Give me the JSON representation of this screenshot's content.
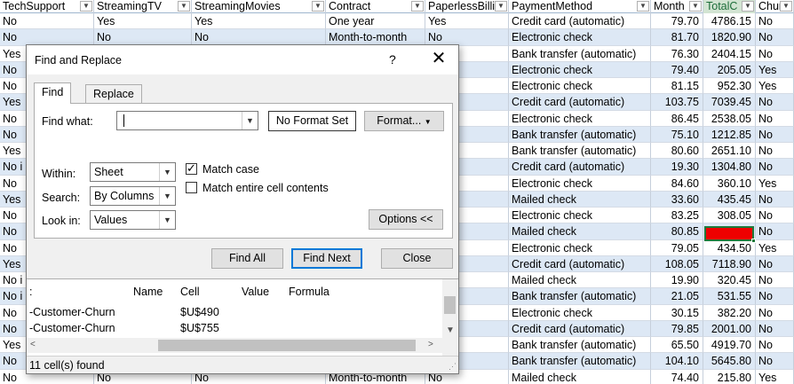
{
  "spreadsheet": {
    "columns": [
      "TechSupport",
      "StreamingTV",
      "StreamingMovies",
      "Contract",
      "PaperlessBilli",
      "PaymentMethod",
      "Month",
      "TotalC",
      "Churn"
    ],
    "selected_column": "TotalC",
    "rows": [
      [
        "No",
        "Yes",
        "Yes",
        "One year",
        "Yes",
        "Credit card (automatic)",
        "79.70",
        "4786.15",
        "No"
      ],
      [
        "No",
        "No",
        "No",
        "Month-to-month",
        "No",
        "Electronic check",
        "81.70",
        "1820.90",
        "No"
      ],
      [
        "Yes",
        "",
        "",
        "",
        "",
        "Bank transfer (automatic)",
        "76.30",
        "2404.15",
        "No"
      ],
      [
        "No",
        "",
        "",
        "",
        "",
        "Electronic check",
        "79.40",
        "205.05",
        "Yes"
      ],
      [
        "No",
        "",
        "",
        "",
        "",
        "Electronic check",
        "81.15",
        "952.30",
        "Yes"
      ],
      [
        "Yes",
        "",
        "",
        "",
        "",
        "Credit card (automatic)",
        "103.75",
        "7039.45",
        "No"
      ],
      [
        "No",
        "",
        "",
        "",
        "",
        "Electronic check",
        "86.45",
        "2538.05",
        "No"
      ],
      [
        "No",
        "",
        "",
        "",
        "",
        "Bank transfer (automatic)",
        "75.10",
        "1212.85",
        "No"
      ],
      [
        "Yes",
        "",
        "",
        "",
        "",
        "Bank transfer (automatic)",
        "80.60",
        "2651.10",
        "No"
      ],
      [
        "No i",
        "",
        "",
        "",
        "",
        "Credit card (automatic)",
        "19.30",
        "1304.80",
        "No"
      ],
      [
        "No",
        "",
        "",
        "",
        "",
        "Electronic check",
        "84.60",
        "360.10",
        "Yes"
      ],
      [
        "Yes",
        "",
        "",
        "",
        "",
        "Mailed check",
        "33.60",
        "435.45",
        "No"
      ],
      [
        "No",
        "",
        "",
        "",
        "",
        "Electronic check",
        "83.25",
        "308.05",
        "No"
      ],
      [
        "No",
        "",
        "",
        "",
        "",
        "Mailed check",
        "80.85",
        "",
        "No"
      ],
      [
        "No",
        "",
        "",
        "",
        "",
        "Electronic check",
        "79.05",
        "434.50",
        "Yes"
      ],
      [
        "Yes",
        "",
        "",
        "",
        "",
        "Credit card (automatic)",
        "108.05",
        "7118.90",
        "No"
      ],
      [
        "No i",
        "",
        "",
        "",
        "",
        "Mailed check",
        "19.90",
        "320.45",
        "No"
      ],
      [
        "No i",
        "",
        "",
        "",
        "",
        "Bank transfer (automatic)",
        "21.05",
        "531.55",
        "No"
      ],
      [
        "No",
        "",
        "",
        "",
        "",
        "Electronic check",
        "30.15",
        "382.20",
        "No"
      ],
      [
        "No",
        "",
        "",
        "",
        "",
        "Credit card (automatic)",
        "79.85",
        "2001.00",
        "No"
      ],
      [
        "Yes",
        "",
        "",
        "",
        "",
        "Bank transfer (automatic)",
        "65.50",
        "4919.70",
        "No"
      ],
      [
        "No",
        "",
        "",
        "",
        "",
        "Bank transfer (automatic)",
        "104.10",
        "5645.80",
        "No"
      ],
      [
        "No",
        "No",
        "No",
        "Month-to-month",
        "No",
        "Mailed check",
        "74.40",
        "215.80",
        "Yes"
      ]
    ],
    "highlight_color": "#ee0000"
  },
  "dialog": {
    "title": "Find and Replace",
    "help": "?",
    "close": "✕",
    "tabs": [
      "Find",
      "Replace"
    ],
    "find_what_label": "Find what:",
    "find_what_value": "",
    "no_format": "No Format Set",
    "format_btn": "Format...",
    "within_label": "Within:",
    "within_value": "Sheet",
    "search_label": "Search:",
    "search_value": "By Columns",
    "lookin_label": "Look in:",
    "lookin_value": "Values",
    "match_case": "Match case",
    "match_case_checked": true,
    "match_entire": "Match entire cell contents",
    "match_entire_checked": false,
    "options_btn": "Options <<",
    "find_all": "Find All",
    "find_next": "Find Next",
    "close_btn": "Close",
    "results": {
      "headers": [
        ":",
        "Name",
        "Cell",
        "Value",
        "Formula"
      ],
      "rows": [
        {
          "book": "-Customer-Churn",
          "cell": "$U$490"
        },
        {
          "book": "-Customer-Churn",
          "cell": "$U$755"
        }
      ]
    },
    "status": "11 cell(s) found"
  }
}
